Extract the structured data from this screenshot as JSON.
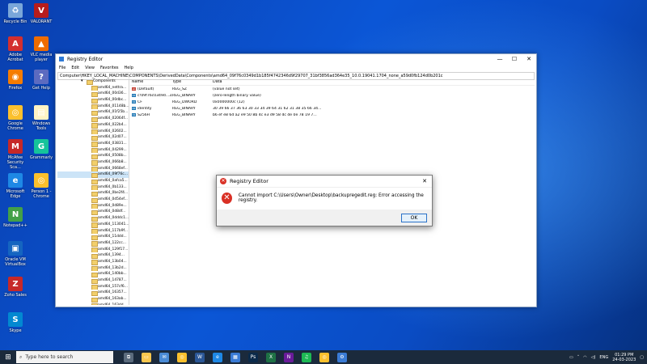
{
  "desktop": {
    "icons": [
      {
        "name": "recycle-bin-icon",
        "label": "Recycle Bin",
        "color": "#7aa7d9",
        "glyph": "♻"
      },
      {
        "name": "acrobat-icon",
        "label": "Adobe Acrobat",
        "color": "#d32f2f",
        "glyph": "A"
      },
      {
        "name": "firefox-icon",
        "label": "Firefox",
        "color": "#f57c00",
        "glyph": "◉"
      },
      {
        "name": "chrome-icon",
        "label": "Google Chrome",
        "color": "#fbc02d",
        "glyph": "◎"
      },
      {
        "name": "mcafee-icon",
        "label": "McAfee Security Sca...",
        "color": "#c62828",
        "glyph": "M"
      },
      {
        "name": "edge-icon",
        "label": "Microsoft Edge",
        "color": "#1e88e5",
        "glyph": "e"
      },
      {
        "name": "notepadpp-icon",
        "label": "Notepad++",
        "color": "#43a047",
        "glyph": "N"
      },
      {
        "name": "virtualbox-icon",
        "label": "Oracle VM VirtualBox",
        "color": "#1565c0",
        "glyph": "▣"
      },
      {
        "name": "zoho-icon",
        "label": "Zoho Sales",
        "color": "#c62828",
        "glyph": "Z"
      },
      {
        "name": "skype-icon",
        "label": "Skype",
        "color": "#0288d1",
        "glyph": "S"
      },
      {
        "name": "valorant-icon",
        "label": "VALORANT",
        "color": "#b71c1c",
        "glyph": "V"
      },
      {
        "name": "vlc-icon",
        "label": "VLC media player",
        "color": "#ef6c00",
        "glyph": "▲"
      },
      {
        "name": "get-help-icon",
        "label": "Get Help",
        "color": "#5c6bc0",
        "glyph": "?"
      },
      {
        "name": "windows-tools-icon",
        "label": "Windows Tools",
        "color": "#fff3c4",
        "glyph": "▤"
      },
      {
        "name": "grammarly-icon",
        "label": "Grammarly",
        "color": "#15c39a",
        "glyph": "G"
      },
      {
        "name": "chrome-profile-icon",
        "label": "Person 1 - Chrome",
        "color": "#fbc02d",
        "glyph": "◎"
      }
    ]
  },
  "regedit": {
    "title": "Registry Editor",
    "menu": [
      "File",
      "Edit",
      "View",
      "Favorites",
      "Help"
    ],
    "address": "Computer\\HKEY_LOCAL_MACHINE\\COMPONENTS\\DerivedData\\Components\\amd64_09f76c0349d1b185f4742346d9f29707_31bf3856ad364e35_10.0.19041.1704_none_a59d0fb124d0b201c",
    "tree_root": "Components",
    "tree_items": [
      "amd64_nettra...",
      "amd64_00d36...",
      "amd64_00dbc...",
      "amd64_01148b...",
      "amd64_01f25b...",
      "amd64_02064f...",
      "amd64_022b4...",
      "amd64_02602...",
      "amd64_02d07...",
      "amd64_03831...",
      "amd64_04299...",
      "amd64_0508b...",
      "amd64_066b8...",
      "amd64_0668ef...",
      "amd64_09f76c...",
      "amd64_0afca5...",
      "amd64_0b133...",
      "amd64_0be2f4...",
      "amd64_0d54ef...",
      "amd64_0d89e...",
      "amd64_0d8df...",
      "amd64_0dddc1...",
      "amd64_113041...",
      "amd64_117b9f...",
      "amd64_11ddd...",
      "amd64_122cc...",
      "amd64_129f17...",
      "amd64_1394...",
      "amd64_13b04...",
      "amd64_13b2d...",
      "amd64_140bb...",
      "amd64_14787...",
      "amd64_157cf6...",
      "amd64_16357...",
      "amd64_163ab...",
      "amd64_163dd..."
    ],
    "selected_tree_index": 14,
    "columns": {
      "name": "Name",
      "type": "Type",
      "data": "Data"
    },
    "values": [
      {
        "name": "(Default)",
        "type": "REG_SZ",
        "data": "(value not set)",
        "kind": "str"
      },
      {
        "name": "c!09f76c0349d...3...",
        "type": "REG_BINARY",
        "data": "(zero-length binary value)",
        "kind": "bin"
      },
      {
        "name": "CF",
        "type": "REG_DWORD",
        "data": "0x0000000c (12)",
        "kind": "bin"
      },
      {
        "name": "identity",
        "type": "REG_BINARY",
        "data": "30 39 66 37 36 63 30 33 34 39 64 31 62 31 38 35 66 34...",
        "kind": "bin"
      },
      {
        "name": "S256H",
        "type": "REG_BINARY",
        "data": "b6 ef e8 6d a2 e9 50 8b 4c e3 d9 58 dc de 0e 78 19 7...",
        "kind": "bin"
      }
    ]
  },
  "dialog": {
    "title": "Registry Editor",
    "message": "Cannot import C:\\Users\\Owner\\Desktop\\backupregedit.reg: Error accessing the registry.",
    "ok_label": "OK"
  },
  "taskbar": {
    "search_placeholder": "Type here to search",
    "apps": [
      {
        "name": "task-view-icon",
        "color": "#5b6b7d",
        "glyph": "⧉"
      },
      {
        "name": "file-explorer-icon",
        "color": "#f9c74f",
        "glyph": "▭"
      },
      {
        "name": "mail-icon",
        "color": "#4a8bd6",
        "glyph": "✉"
      },
      {
        "name": "chrome-taskbar-icon",
        "color": "#fbc02d",
        "glyph": "◎"
      },
      {
        "name": "word-icon",
        "color": "#2b5797",
        "glyph": "W"
      },
      {
        "name": "edge-taskbar-icon",
        "color": "#1e88e5",
        "glyph": "e"
      },
      {
        "name": "store-icon",
        "color": "#3a7bd5",
        "glyph": "▦"
      },
      {
        "name": "photoshop-icon",
        "color": "#0b2a4a",
        "glyph": "Ps"
      },
      {
        "name": "excel-icon",
        "color": "#1e7145",
        "glyph": "X"
      },
      {
        "name": "onenote-icon",
        "color": "#6a1b9a",
        "glyph": "N"
      },
      {
        "name": "spotify-icon",
        "color": "#1db954",
        "glyph": "♫"
      },
      {
        "name": "chrome-taskbar-icon-2",
        "color": "#fbc02d",
        "glyph": "◎"
      },
      {
        "name": "regedit-taskbar-icon",
        "color": "#3a7bd5",
        "glyph": "⚙"
      }
    ],
    "language": "ENG",
    "time": "01:29 PM",
    "date": "24-03-2023"
  }
}
